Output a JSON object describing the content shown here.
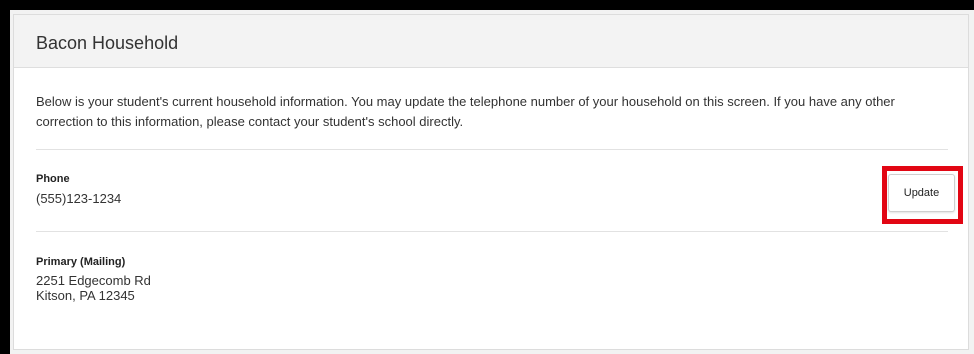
{
  "household": {
    "title": "Bacon Household",
    "intro": "Below is your student's current household information.  You may update the telephone number of your household on this screen.  If you have any other correction to this information, please contact your student's school directly."
  },
  "phone": {
    "label": "Phone",
    "value": "(555)123-1234",
    "update_label": "Update"
  },
  "address": {
    "label": "Primary (Mailing)",
    "line1": "2251 Edgecomb Rd",
    "line2": "Kitson, PA 12345"
  },
  "colors": {
    "highlight": "#e20613",
    "frame": "#000000",
    "header_bg": "#f3f3f3"
  }
}
